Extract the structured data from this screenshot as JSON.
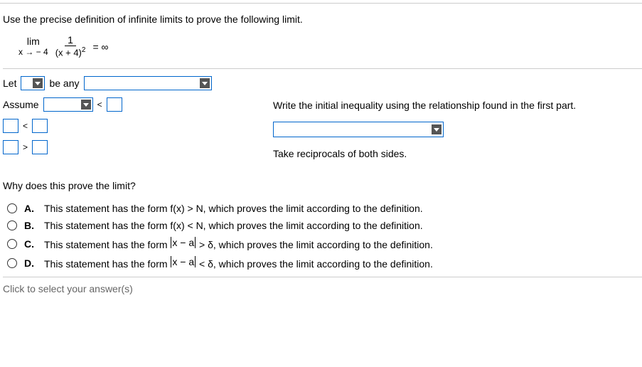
{
  "prompt": "Use the precise definition of infinite limits to prove the following limit.",
  "limit": {
    "lim_word": "lim",
    "approach": "x → − 4",
    "numerator": "1",
    "denominator_base": "(x + 4)",
    "denominator_exp": "2",
    "rhs": "= ∞"
  },
  "line_let": {
    "let": "Let",
    "be_any": "be any"
  },
  "line_assume": {
    "assume": "Assume",
    "lt": "<"
  },
  "step_boxes": {
    "lt": "<",
    "gt": ">"
  },
  "right_steps": {
    "step1": "Write the initial inequality using the relationship found in the first part.",
    "step2": "Take reciprocals of both sides."
  },
  "question": "Why does this prove the limit?",
  "options": {
    "A_label": "A.",
    "A_text": "This statement has the form f(x) > N, which proves the limit according to the definition.",
    "B_label": "B.",
    "B_text": "This statement has the form f(x) < N, which proves the limit according to the definition.",
    "C_label": "C.",
    "C_pre": "This statement has the form ",
    "C_mid": "x − a",
    "C_post": " > δ, which proves the limit according to the definition.",
    "D_label": "D.",
    "D_pre": "This statement has the form ",
    "D_mid": "x − a",
    "D_post": " < δ, which proves the limit according to the definition."
  },
  "bottom_cut": "Click to select your answer(s)"
}
